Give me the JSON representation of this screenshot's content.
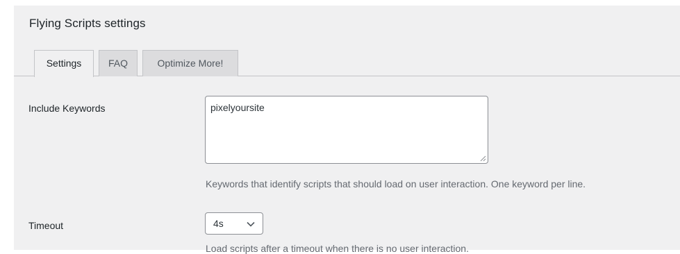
{
  "page": {
    "title": "Flying Scripts settings"
  },
  "tabs": [
    {
      "label": "Settings",
      "active": true
    },
    {
      "label": "FAQ",
      "active": false
    },
    {
      "label": "Optimize More!",
      "active": false
    }
  ],
  "fields": {
    "include_keywords": {
      "label": "Include Keywords",
      "value": "pixelyoursite",
      "description": "Keywords that identify scripts that should load on user interaction. One keyword per line."
    },
    "timeout": {
      "label": "Timeout",
      "value": "4s",
      "description": "Load scripts after a timeout when there is no user interaction."
    }
  },
  "icons": {
    "select_chevron": "chevron-down-icon",
    "resize_grip": "resize-grip-icon"
  },
  "colors": {
    "background": "#f0f0f1",
    "tab_inactive": "#dcdcde",
    "border": "#c3c4c7",
    "input_border": "#8c8f94",
    "text": "#1d2327",
    "description_text": "#646970"
  }
}
